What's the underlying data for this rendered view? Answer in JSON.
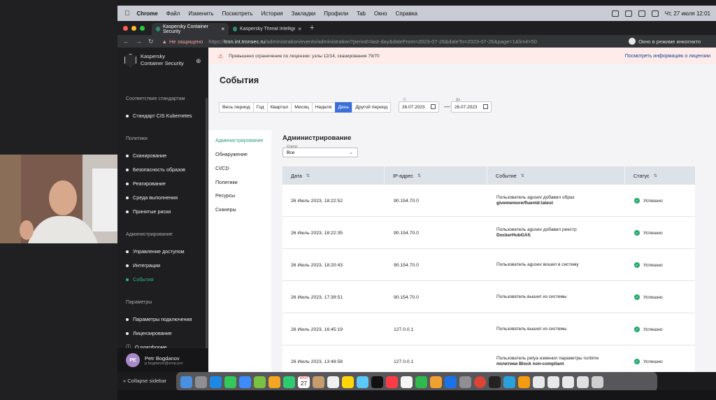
{
  "menubar": {
    "app": "Chrome",
    "items": [
      "Файл",
      "Изменить",
      "Посмотреть",
      "История",
      "Закладки",
      "Профили",
      "Tab",
      "Окно",
      "Справка"
    ],
    "clock": "Чт, 27 июля  12:01"
  },
  "browser": {
    "tabs": [
      {
        "title": "Kaspersky Container Security",
        "active": true
      },
      {
        "title": "Kaspersky Threat Intelligence",
        "active": false
      }
    ],
    "security_warning": "Не защищено",
    "url_prefix": "https://",
    "url_host": "tron.int.tronsec.ru",
    "url_path": "/administration/events/administration?period=last-day&dateFrom=2023-07-26&dateTo=2023-07-26&page=1&limit=50",
    "incognito_label": "Окно в режиме инкогнито"
  },
  "sidebar": {
    "brand_line1": "Kaspersky",
    "brand_line2": "Container Security",
    "sections": [
      {
        "title": "Соответствие стандартам",
        "items": [
          {
            "label": "Стандарт CIS Kubernetes",
            "active": false
          }
        ]
      },
      {
        "title": "Политики",
        "items": [
          {
            "label": "Сканирование",
            "active": false
          },
          {
            "label": "Безопасность образов",
            "active": false
          },
          {
            "label": "Реагирование",
            "active": false
          },
          {
            "label": "Среда выполнения",
            "active": false
          },
          {
            "label": "Принятые риски",
            "active": false
          }
        ]
      },
      {
        "title": "Администрирование",
        "items": [
          {
            "label": "Управление доступом",
            "active": false
          },
          {
            "label": "Интеграции",
            "active": false
          },
          {
            "label": "События",
            "active": true
          }
        ]
      },
      {
        "title": "Параметры",
        "items": [
          {
            "label": "Параметры подключения",
            "active": false
          },
          {
            "label": "Лицензирование",
            "active": false
          }
        ]
      }
    ],
    "about": "О платформе",
    "user": {
      "initials": "PE",
      "name": "Petr Bogdanov",
      "email": "p.bogdanov@emp.pro"
    }
  },
  "banner": {
    "text": "Превышено ограничение по лицензии: узлы 12/14, сканирования 79/70",
    "link": "Посмотреть информацию о лицензии"
  },
  "page": {
    "title": "События",
    "periods": [
      {
        "label": "Весь период",
        "active": false
      },
      {
        "label": "Год",
        "active": false
      },
      {
        "label": "Квартал",
        "active": false
      },
      {
        "label": "Месяц",
        "active": false
      },
      {
        "label": "Неделя",
        "active": false
      },
      {
        "label": "День",
        "active": true
      },
      {
        "label": "Другой период",
        "active": false
      }
    ],
    "date_from_label": "С",
    "date_from": "26.07.2023",
    "date_to_label": "До",
    "date_to": "26.07.2023",
    "dash": "—",
    "categories": [
      {
        "label": "Администрирование",
        "active": true
      },
      {
        "label": "Обнаружение",
        "active": false
      },
      {
        "label": "CI/CD",
        "active": false
      },
      {
        "label": "Политики",
        "active": false
      },
      {
        "label": "Ресурсы",
        "active": false
      },
      {
        "label": "Сканеры",
        "active": false
      }
    ],
    "section_title": "Администрирование",
    "status_filter_label": "Статус",
    "status_filter_value": "Все",
    "columns": [
      "Дата",
      "IP-адрес",
      "Событие",
      "Статус"
    ],
    "rows": [
      {
        "date": "26 Июль 2023, 18:22:52",
        "ip": "90.154.70.0",
        "event_line1": "Пользователь agusev добавил образ",
        "event_line2": "givememore/fluentd:latest",
        "status": "Успешно"
      },
      {
        "date": "26 Июль 2023, 18:22:35",
        "ip": "90.154.70.0",
        "event_line1": "Пользователь agusev добавил реестр",
        "event_line2": "DockerHubGAS",
        "status": "Успешно"
      },
      {
        "date": "26 Июль 2023, 18:20:43",
        "ip": "90.154.70.0",
        "event_line1": "Пользователь agusev вошел в систему",
        "event_line2": "",
        "status": "Успешно"
      },
      {
        "date": "26 Июль 2023, 17:39:51",
        "ip": "90.154.70.0",
        "event_line1": "Пользователь  вышел из системы",
        "event_line2": "",
        "status": "Успешно"
      },
      {
        "date": "26 Июль 2023, 16:45:19",
        "ip": "127.0.0.1",
        "event_line1": "Пользователь  вышел из системы",
        "event_line2": "",
        "status": "Успешно"
      },
      {
        "date": "26 Июль 2023, 13:48:58",
        "ip": "127.0.0.1",
        "event_line1": "Пользователь petya изменил параметры runtime",
        "event_line2": "политики Block non-compliant",
        "status": "Успешно"
      }
    ]
  },
  "bottom": {
    "collapse_label": "Collapse sidebar",
    "calendar_day": "27",
    "calendar_month": "ИЮЛ"
  },
  "colors": {
    "accent": "#3a6fd8",
    "active_green": "#2fb38a",
    "success": "#1fa76e",
    "banner_bg": "#fdecea"
  }
}
